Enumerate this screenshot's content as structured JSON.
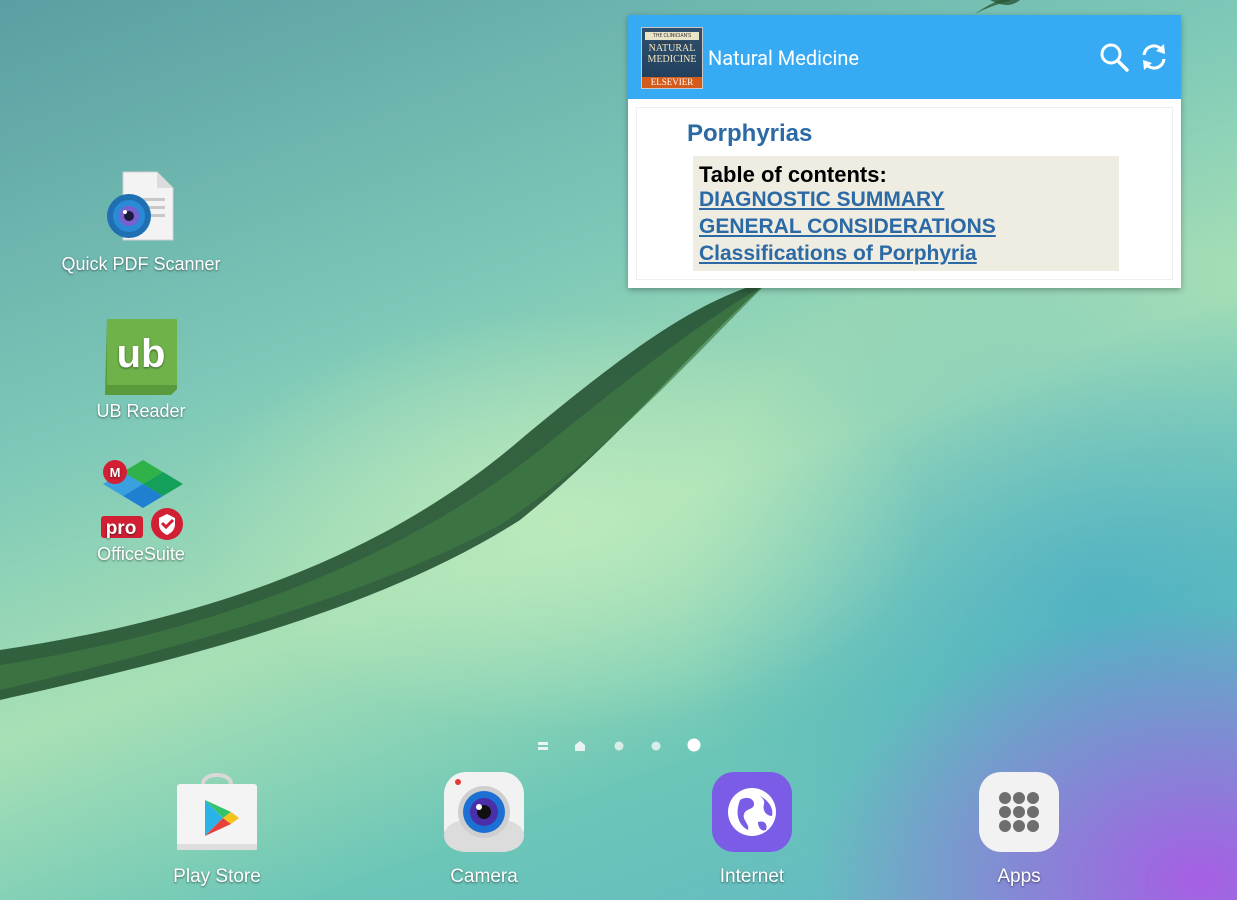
{
  "desktop_icons": [
    {
      "label": "Quick PDF Scanner",
      "icon": "quick-pdf-scanner-icon"
    },
    {
      "label": "UB Reader",
      "icon": "ub-reader-icon",
      "icon_text": "ub"
    },
    {
      "label": "OfficeSuite",
      "icon": "officesuite-icon",
      "icon_text": "pro"
    }
  ],
  "widget": {
    "app_title": "Natural Medicine",
    "cover": {
      "top": "THE CLINICIAN'S HANDBOOK OF",
      "title": "NATURAL MEDICINE",
      "publisher": "ELSEVIER"
    },
    "topic": "Porphyrias",
    "toc_heading": "Table of contents:",
    "toc_links": [
      "DIAGNOSTIC SUMMARY",
      "GENERAL CONSIDERATIONS",
      "Classifications of Porphyria"
    ],
    "header_color": "#36aaf3",
    "link_color": "#2b6aa5"
  },
  "page_indicators": {
    "count": 5,
    "active_index": 4
  },
  "dock": [
    {
      "label": "Play Store",
      "icon": "play-store-icon"
    },
    {
      "label": "Camera",
      "icon": "camera-icon"
    },
    {
      "label": "Internet",
      "icon": "internet-icon"
    },
    {
      "label": "Apps",
      "icon": "apps-grid-icon"
    }
  ]
}
